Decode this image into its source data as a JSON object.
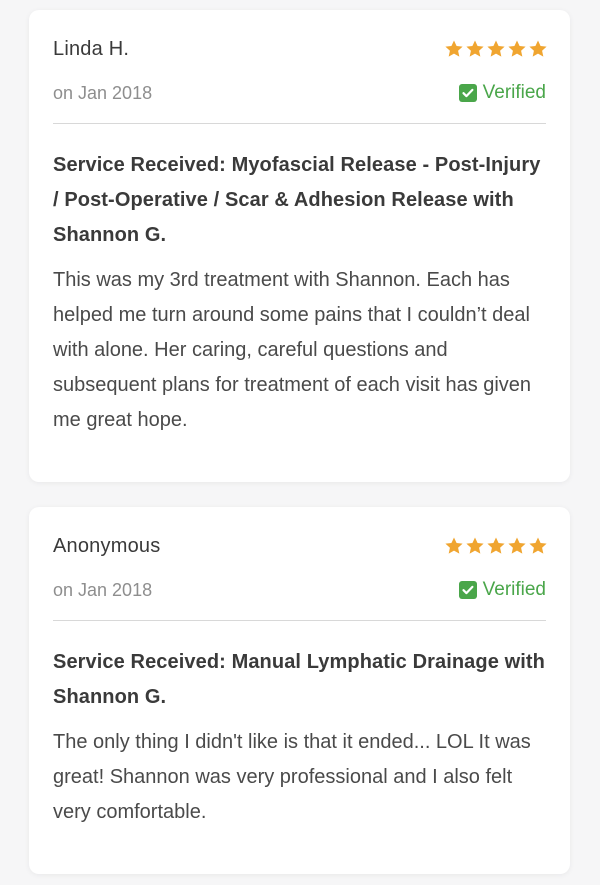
{
  "reviews": [
    {
      "name": "Linda H.",
      "date": "on Jan 2018",
      "rating": 5,
      "verified_label": "Verified",
      "service": "Service Received: Myofascial Release - Post-Injury / Post-Operative / Scar & Adhesion Release with Shannon G.",
      "text": "This was my 3rd treatment with Shannon. Each has helped me turn around some pains that I couldn’t deal with alone. Her caring, careful questions and subsequent plans for treatment of each visit has given me great hope."
    },
    {
      "name": "Anonymous",
      "date": "on Jan 2018",
      "rating": 5,
      "verified_label": "Verified",
      "service": "Service Received: Manual Lymphatic Drainage with Shannon G.",
      "text": "The only thing I didn't like is that it ended... LOL It was great! Shannon was very professional and I also felt very comfortable."
    }
  ],
  "colors": {
    "star": "#f0a530",
    "verified": "#4aa64a"
  },
  "icons": {
    "rating": "star-icon",
    "verified": "checkbox-checked-icon"
  }
}
